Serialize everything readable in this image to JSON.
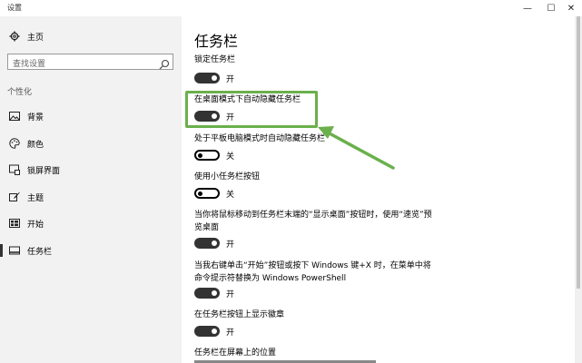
{
  "window": {
    "title": "设置",
    "minimize": "—",
    "maximize": "☐",
    "close": "✕"
  },
  "sidebar": {
    "home": "主页",
    "search_placeholder": "查找设置",
    "section": "个性化",
    "items": [
      {
        "label": "背景",
        "icon": "picture-icon"
      },
      {
        "label": "颜色",
        "icon": "palette-icon"
      },
      {
        "label": "锁屏界面",
        "icon": "lock-screen-icon"
      },
      {
        "label": "主题",
        "icon": "brush-icon"
      },
      {
        "label": "开始",
        "icon": "start-icon"
      },
      {
        "label": "任务栏",
        "icon": "taskbar-icon",
        "active": true
      }
    ]
  },
  "main": {
    "title": "任务栏",
    "settings": [
      {
        "label": "锁定任务栏",
        "state": "开",
        "on": true
      },
      {
        "label": "在桌面模式下自动隐藏任务栏",
        "state": "开",
        "on": true
      },
      {
        "label": "处于平板电脑模式时自动隐藏任务栏",
        "state": "关",
        "on": false
      },
      {
        "label": "使用小任务栏按钮",
        "state": "关",
        "on": false
      },
      {
        "label_line1": "当你将鼠标移动到任务栏末端的“显示桌面”按钮时，使用“速览”预",
        "label_line2": "览桌面",
        "state": "开",
        "on": true
      },
      {
        "label_line1": "当我右键单击“开始”按钮或按下 Windows 键+X 时，在菜单中将",
        "label_line2": "命令提示符替换为 Windows PowerShell",
        "state": "开",
        "on": true
      },
      {
        "label": "在任务栏按钮上显示徽章",
        "state": "开",
        "on": true
      },
      {
        "label": "任务栏在屏幕上的位置"
      }
    ]
  },
  "colors": {
    "highlight": "#6ab04c",
    "toggle_on": "#333333",
    "sidebar_bg": "#f2f2f2"
  }
}
